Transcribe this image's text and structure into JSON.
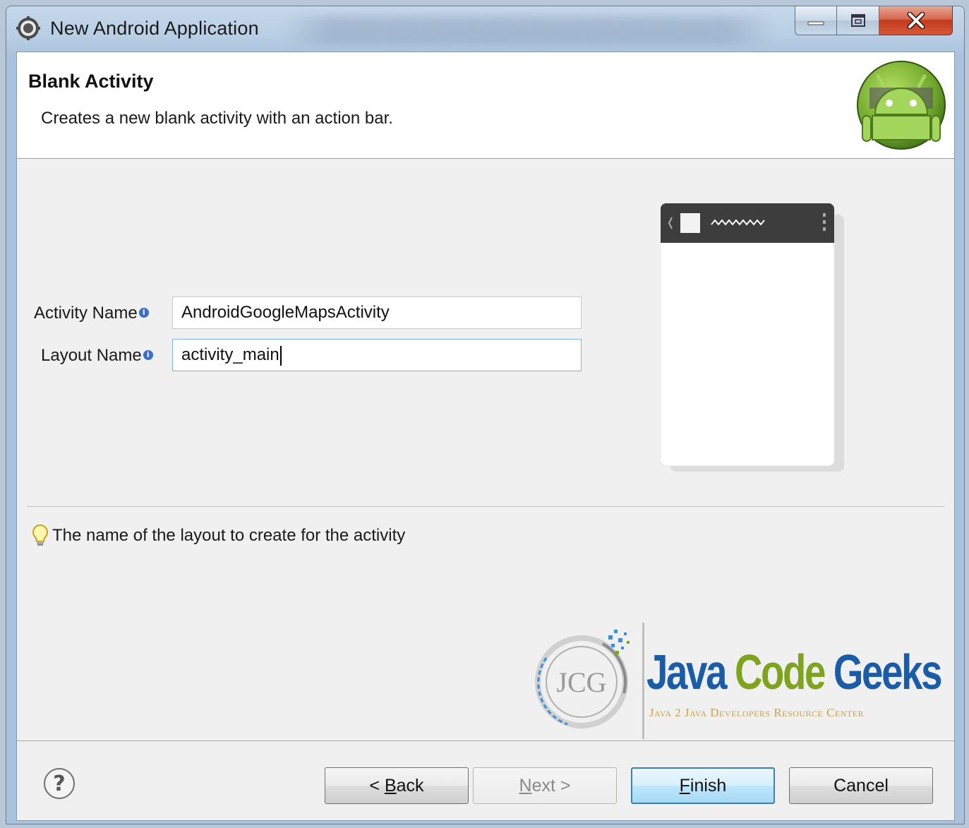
{
  "window": {
    "title": "New Android Application",
    "controls": {
      "minimize": "minimize",
      "maximize": "maximize",
      "close": "close"
    }
  },
  "header": {
    "title": "Blank Activity",
    "description": "Creates a new blank activity with an action bar."
  },
  "form": {
    "activity_name": {
      "label": "Activity Name",
      "value": "AndroidGoogleMapsActivity",
      "info_icon": "info-icon"
    },
    "layout_name": {
      "label": "Layout Name",
      "value": "activity_main",
      "info_icon": "info-icon"
    }
  },
  "hint": {
    "text": "The name of the layout to create for the activity",
    "icon": "lightbulb-icon"
  },
  "watermark": {
    "logo_text": "JCG",
    "title_parts": [
      "Java",
      "Code",
      "Geeks"
    ],
    "subtitle": "Java 2 Java Developers Resource Center"
  },
  "buttons": {
    "back": {
      "prefix": "< ",
      "mnemonic": "B",
      "rest": "ack"
    },
    "next": {
      "mnemonic": "N",
      "rest": "ext >",
      "enabled": false
    },
    "finish": {
      "mnemonic": "F",
      "rest": "inish"
    },
    "cancel": {
      "label": "Cancel"
    }
  },
  "colors": {
    "jcg_blue": "#1a5ca8",
    "jcg_green": "#7ea31c",
    "android_green": "#8cc63f",
    "focus_border": "#7eb4ea"
  }
}
